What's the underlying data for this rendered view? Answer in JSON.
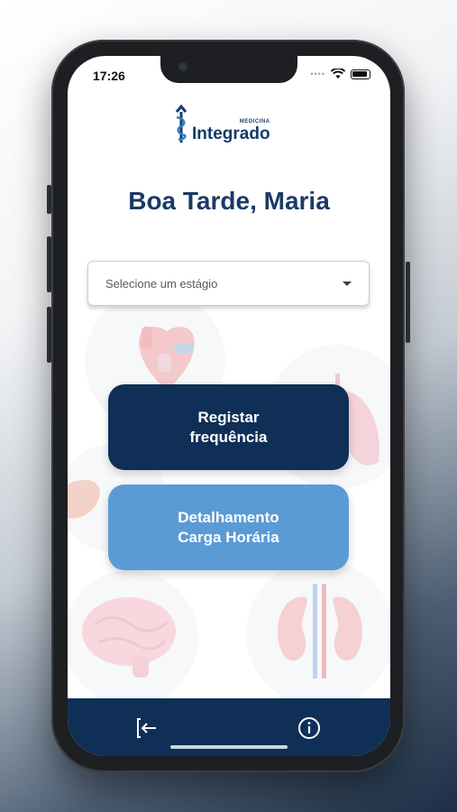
{
  "status_bar": {
    "time": "17:26",
    "icons": [
      "signal-dots-icon",
      "wifi-icon",
      "battery-icon"
    ]
  },
  "logo": {
    "small_text": "MEDICINA",
    "main_text": "Integrado",
    "icon": "caduceus-icon"
  },
  "greeting": "Boa Tarde, Maria",
  "stage_select": {
    "placeholder": "Selecione um estágio"
  },
  "buttons": {
    "register_line1": "Registar",
    "register_line2": "frequência",
    "detail_line1": "Detalhamento",
    "detail_line2": "Carga Horária"
  },
  "bottom_nav": {
    "items": [
      "logout-icon",
      "info-icon"
    ]
  },
  "colors": {
    "primary": "#102f57",
    "secondary": "#5a9bd6",
    "title": "#1a3a66"
  }
}
